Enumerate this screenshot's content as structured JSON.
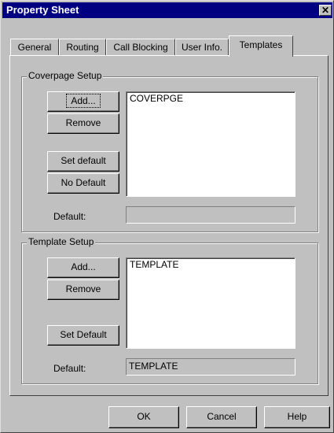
{
  "window": {
    "title": "Property Sheet",
    "close_glyph": "✕"
  },
  "tabs": [
    {
      "label": "General"
    },
    {
      "label": "Routing"
    },
    {
      "label": "Call Blocking"
    },
    {
      "label": "User Info."
    },
    {
      "label": "Templates",
      "active": true
    }
  ],
  "coverpage": {
    "title": "Coverpage Setup",
    "add_label": "Add...",
    "remove_label": "Remove",
    "set_default_label": "Set default",
    "no_default_label": "No Default",
    "items": [
      "COVERPGE"
    ],
    "default_label": "Default:",
    "default_value": ""
  },
  "template": {
    "title": "Template Setup",
    "add_label": "Add...",
    "remove_label": "Remove",
    "set_default_label": "Set Default",
    "items": [
      "TEMPLATE"
    ],
    "default_label": "Default:",
    "default_value": "TEMPLATE"
  },
  "footer": {
    "ok_label": "OK",
    "cancel_label": "Cancel",
    "help_label": "Help"
  }
}
